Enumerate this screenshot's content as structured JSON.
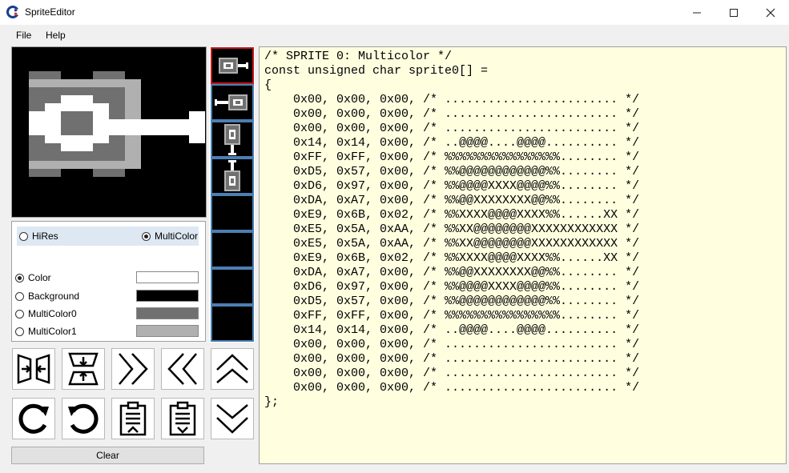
{
  "window": {
    "title": "SpriteEditor",
    "controls": [
      "minimize",
      "maximize",
      "close"
    ]
  },
  "menu": {
    "items": [
      "File",
      "Help"
    ]
  },
  "mode": {
    "options": [
      "HiRes",
      "MultiColor"
    ],
    "selected": "MultiColor"
  },
  "colors": {
    "selected": "Color",
    "items": [
      {
        "label": "Color",
        "value": "#ffffff"
      },
      {
        "label": "Background",
        "value": "#000000"
      },
      {
        "label": "MultiColor0",
        "value": "#707070"
      },
      {
        "label": "MultiColor1",
        "value": "#b0b0b0"
      }
    ]
  },
  "tools": {
    "row1": [
      "compress-horizontal-icon",
      "compress-vertical-icon",
      "shift-right-icon",
      "shift-left-icon",
      "shift-up-icon"
    ],
    "row2": [
      "rotate-cw-icon",
      "rotate-ccw-icon",
      "paste-icon",
      "paste-down-icon",
      "shift-down-icon"
    ]
  },
  "clear_label": "Clear",
  "sprites": {
    "count": 8,
    "selected_index": 0
  },
  "code": {
    "lines": [
      "/* SPRITE 0: Multicolor */",
      "const unsigned char sprite0[] =",
      "{",
      "    0x00, 0x00, 0x00, /* ........................ */",
      "    0x00, 0x00, 0x00, /* ........................ */",
      "    0x00, 0x00, 0x00, /* ........................ */",
      "    0x14, 0x14, 0x00, /* ..@@@@....@@@@.......... */",
      "    0xFF, 0xFF, 0x00, /* %%%%%%%%%%%%%%%%........ */",
      "    0xD5, 0x57, 0x00, /* %%@@@@@@@@@@@@%%........ */",
      "    0xD6, 0x97, 0x00, /* %%@@@@XXXX@@@@%%........ */",
      "    0xDA, 0xA7, 0x00, /* %%@@XXXXXXXX@@%%........ */",
      "    0xE9, 0x6B, 0x02, /* %%XXXX@@@@XXXX%%......XX */",
      "    0xE5, 0x5A, 0xAA, /* %%XX@@@@@@@@XXXXXXXXXXXX */",
      "    0xE5, 0x5A, 0xAA, /* %%XX@@@@@@@@XXXXXXXXXXXX */",
      "    0xE9, 0x6B, 0x02, /* %%XXXX@@@@XXXX%%......XX */",
      "    0xDA, 0xA7, 0x00, /* %%@@XXXXXXXX@@%%........ */",
      "    0xD6, 0x97, 0x00, /* %%@@@@XXXX@@@@%%........ */",
      "    0xD5, 0x57, 0x00, /* %%@@@@@@@@@@@@%%........ */",
      "    0xFF, 0xFF, 0x00, /* %%%%%%%%%%%%%%%%........ */",
      "    0x14, 0x14, 0x00, /* ..@@@@....@@@@.......... */",
      "    0x00, 0x00, 0x00, /* ........................ */",
      "    0x00, 0x00, 0x00, /* ........................ */",
      "    0x00, 0x00, 0x00, /* ........................ */",
      "    0x00, 0x00, 0x00, /* ........................ */",
      "};"
    ]
  }
}
